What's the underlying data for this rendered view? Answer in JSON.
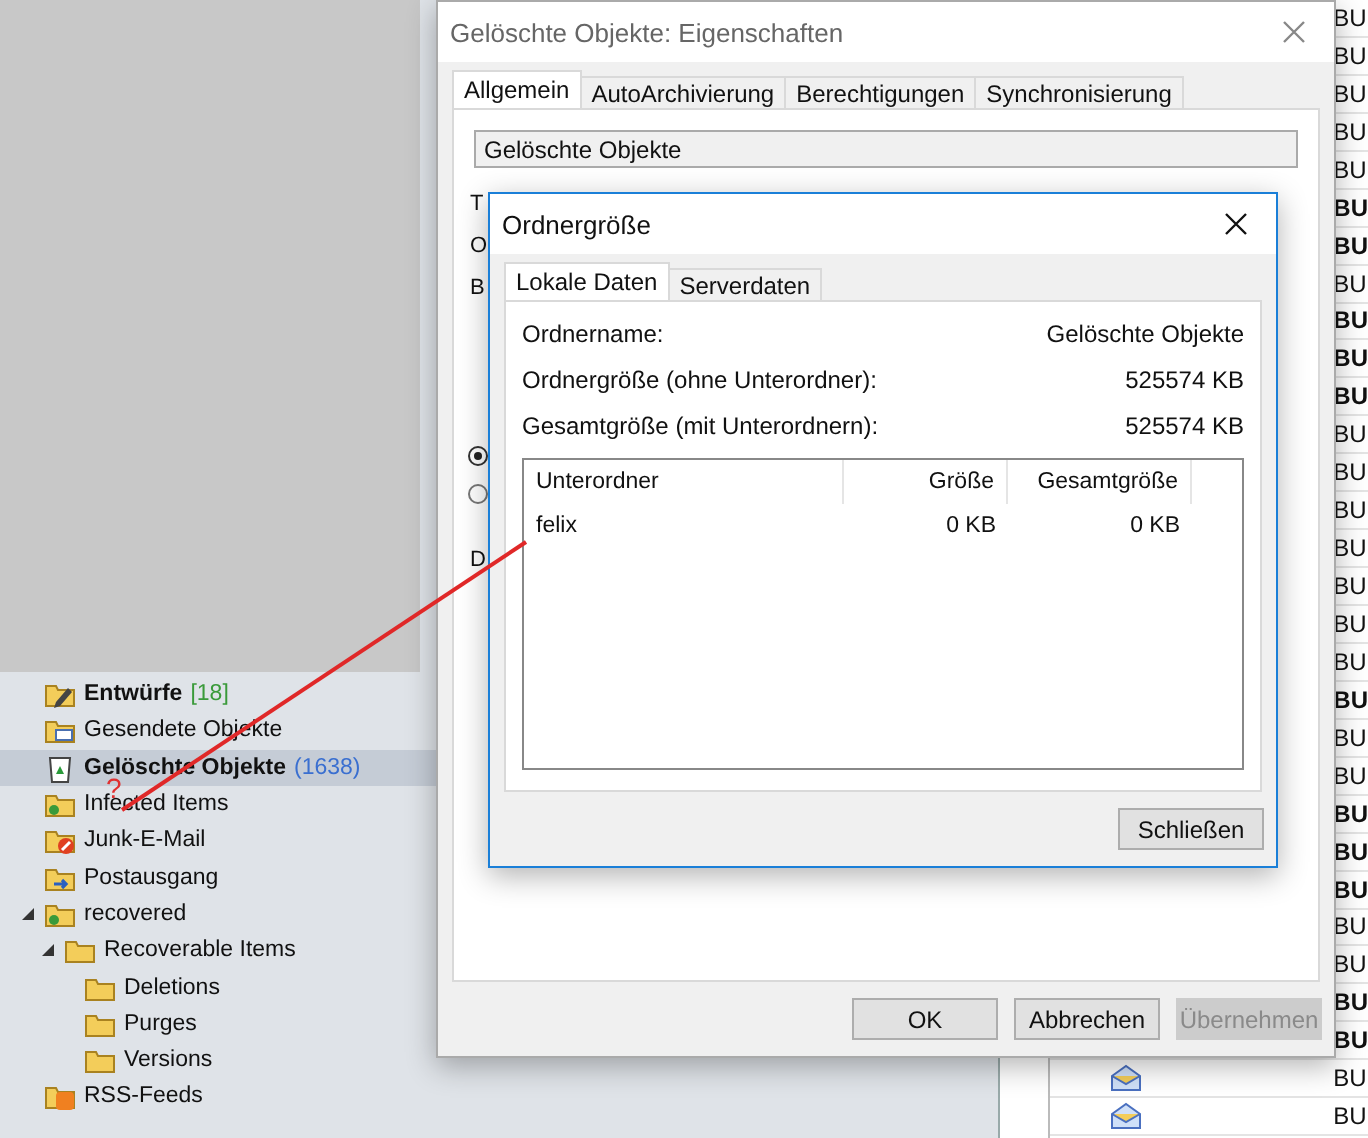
{
  "folders": [
    {
      "label": "Entwürfe",
      "count": "[18]",
      "color": "#3a9a3a",
      "kind": "drafts",
      "bold": true,
      "selected": false
    },
    {
      "label": "Gesendete Objekte",
      "kind": "sent",
      "bold": false,
      "selected": false
    },
    {
      "label": "Gelöschte Objekte",
      "count": "(1638)",
      "color": "#3a6fd0",
      "kind": "trash",
      "bold": true,
      "selected": true
    },
    {
      "label": "Infected Items",
      "kind": "shared",
      "bold": false,
      "selected": false
    },
    {
      "label": "Junk-E-Mail",
      "kind": "junk",
      "bold": false,
      "selected": false
    },
    {
      "label": "Postausgang",
      "kind": "outbox",
      "bold": false,
      "selected": false
    },
    {
      "label": "recovered",
      "kind": "shared",
      "bold": false,
      "selected": false,
      "expanded": true,
      "children": [
        {
          "label": "Recoverable Items",
          "kind": "folder",
          "bold": false,
          "selected": false,
          "expanded": true,
          "children": [
            {
              "label": "Deletions",
              "kind": "folder",
              "bold": false,
              "selected": false
            },
            {
              "label": "Purges",
              "kind": "folder",
              "bold": false,
              "selected": false
            },
            {
              "label": "Versions",
              "kind": "folder",
              "bold": false,
              "selected": false
            }
          ]
        }
      ]
    },
    {
      "label": "RSS-Feeds",
      "kind": "rss",
      "bold": false,
      "selected": false
    }
  ],
  "annotation": {
    "mark": "?"
  },
  "messages": [
    {
      "text": "BU",
      "unread": false
    },
    {
      "text": "BU",
      "unread": false
    },
    {
      "text": "BU",
      "unread": false
    },
    {
      "text": "BU",
      "unread": false
    },
    {
      "text": "BU",
      "unread": false
    },
    {
      "text": "BU",
      "unread": true
    },
    {
      "text": "BU",
      "unread": true
    },
    {
      "text": "BU",
      "unread": false
    },
    {
      "text": "BU",
      "unread": true
    },
    {
      "text": "BU",
      "unread": true
    },
    {
      "text": "BU",
      "unread": true
    },
    {
      "text": "BU",
      "unread": false
    },
    {
      "text": "BU",
      "unread": false
    },
    {
      "text": "BU",
      "unread": false
    },
    {
      "text": "BU",
      "unread": false
    },
    {
      "text": "BU",
      "unread": false
    },
    {
      "text": "BU",
      "unread": false
    },
    {
      "text": "BU",
      "unread": false
    },
    {
      "text": "BU",
      "unread": true
    },
    {
      "text": "BU",
      "unread": false
    },
    {
      "text": "BU",
      "unread": false
    },
    {
      "text": "BU",
      "unread": true
    },
    {
      "text": "BU",
      "unread": true
    },
    {
      "text": "BU",
      "unread": true
    },
    {
      "text": "BU",
      "unread": false
    },
    {
      "text": "BU",
      "unread": false
    },
    {
      "text": "BU",
      "unread": true
    },
    {
      "text": "BU",
      "unread": true
    },
    {
      "text": "BU",
      "unread": false,
      "envelope": true
    },
    {
      "text": "BU",
      "unread": false,
      "envelope": true
    }
  ],
  "properties": {
    "title": "Gelöschte Objekte: Eigenschaften",
    "tabs": [
      {
        "label": "Allgemein",
        "selected": true
      },
      {
        "label": "AutoArchivierung",
        "selected": false
      },
      {
        "label": "Berechtigungen",
        "selected": false
      },
      {
        "label": "Synchronisierung",
        "selected": false
      }
    ],
    "name_field": "Gelöschte Objekte",
    "fragments": [
      "T",
      "O",
      "B"
    ],
    "radios": [
      {
        "selected": true
      },
      {
        "selected": false
      }
    ],
    "fragment_bottom": "D",
    "buttons": [
      {
        "label": "OK",
        "disabled": false
      },
      {
        "label": "Abbrechen",
        "disabled": false
      },
      {
        "label": "Übernehmen",
        "disabled": true
      }
    ]
  },
  "folder_size": {
    "title": "Ordnergröße",
    "tabs": [
      {
        "label": "Lokale Daten",
        "selected": true
      },
      {
        "label": "Serverdaten",
        "selected": false
      }
    ],
    "fields": [
      {
        "label": "Ordnername:",
        "value": "Gelöschte Objekte"
      },
      {
        "label": "Ordnergröße (ohne Unterordner):",
        "value": "525574 KB"
      },
      {
        "label": "Gesamtgröße (mit Unterordnern):",
        "value": "525574 KB"
      }
    ],
    "table": {
      "columns": [
        "Unterordner",
        "Größe",
        "Gesamtgröße"
      ],
      "rows": [
        [
          "felix",
          "0 KB",
          "0 KB"
        ]
      ]
    },
    "close_button": "Schließen"
  }
}
